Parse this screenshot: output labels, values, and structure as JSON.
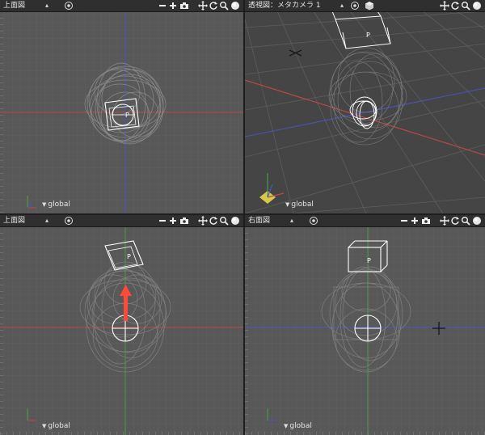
{
  "viewports": {
    "top_left": {
      "title": "上面図",
      "menu_caret": "▴",
      "coord_label": "global"
    },
    "top_right": {
      "title": "透視図：メタカメラ 1",
      "menu_caret": "▴",
      "coord_label": "global"
    },
    "bottom_left": {
      "title": "上面図",
      "menu_caret": "▴",
      "coord_label": "global"
    },
    "bottom_right": {
      "title": "右面図",
      "menu_caret": "▴",
      "coord_label": "global"
    }
  },
  "camera_object": {
    "label": "P"
  },
  "colors": {
    "viewport_bg": "#585858",
    "perspective_bg": "#444444",
    "grid_line": "#6a6a6a",
    "axis_x": "#c04848",
    "axis_y": "#4e9a4e",
    "axis_z": "#4a54b8",
    "selection_arrow": "#ff4a3a",
    "wire_white": "#ffffff",
    "wire_grey": "#8a8a8a"
  },
  "toolbar_icons": [
    "target-icon",
    "minus-icon",
    "plus-icon",
    "camera-icon",
    "move-icon",
    "rotate-icon",
    "zoom-icon",
    "view-sphere-icon"
  ]
}
